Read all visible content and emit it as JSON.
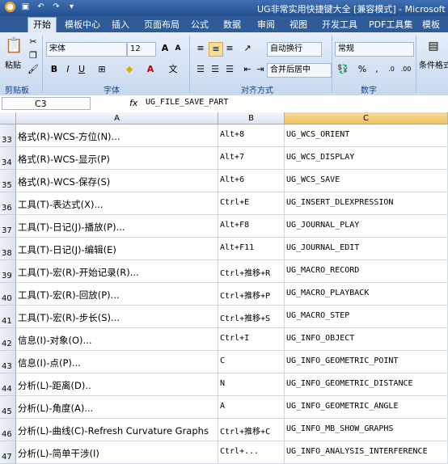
{
  "window": {
    "title": "UG非常实用快捷键大全 [兼容模式] - Microsoft"
  },
  "tabs": [
    "开始",
    "模板中心",
    "插入",
    "页面布局",
    "公式",
    "数据",
    "审阅",
    "视图",
    "开发工具",
    "PDF工具集",
    "模板"
  ],
  "ribbon": {
    "paste_label": "粘贴",
    "clipboard_label": "剪贴板",
    "font_name": "宋体",
    "font_size": "12",
    "font_group_label": "字体",
    "wrap_text_label": "自动换行",
    "merge_center_label": "合并后居中",
    "align_group_label": "对齐方式",
    "number_format": "常规",
    "number_group_label": "数字",
    "conditional_format_label": "条件格式"
  },
  "formula_bar": {
    "cell_ref": "C3",
    "fx": "fx",
    "content": "UG_FILE_SAVE_PART"
  },
  "columns": [
    "A",
    "B",
    "C"
  ],
  "rows": [
    {
      "num": "33",
      "a": "格式(R)-WCS-方位(N)...",
      "b": "Alt+8",
      "c": "UG_WCS_ORIENT"
    },
    {
      "num": "34",
      "a": "格式(R)-WCS-显示(P)",
      "b": "Alt+7",
      "c": "UG_WCS_DISPLAY"
    },
    {
      "num": "35",
      "a": "格式(R)-WCS-保存(S)",
      "b": "Alt+6",
      "c": "UG_WCS_SAVE"
    },
    {
      "num": "36",
      "a": "工具(T)-表达式(X)...",
      "b": "Ctrl+E",
      "c": "UG_INSERT_DLEXPRESSION"
    },
    {
      "num": "37",
      "a": "工具(T)-日记(J)-播放(P)...",
      "b": "Alt+F8",
      "c": "UG_JOURNAL_PLAY"
    },
    {
      "num": "38",
      "a": "工具(T)-日记(J)-编辑(E)",
      "b": "Alt+F11",
      "c": "UG_JOURNAL_EDIT"
    },
    {
      "num": "39",
      "a": "工具(T)-宏(R)-开始记录(R)...",
      "b": "Ctrl+推移+R",
      "c": "UG_MACRO_RECORD"
    },
    {
      "num": "40",
      "a": "工具(T)-宏(R)-回放(P)...",
      "b": "Ctrl+推移+P",
      "c": "UG_MACRO_PLAYBACK"
    },
    {
      "num": "41",
      "a": "工具(T)-宏(R)-步长(S)...",
      "b": "Ctrl+推移+S",
      "c": "UG_MACRO_STEP"
    },
    {
      "num": "42",
      "a": "信息(I)-对象(O)...",
      "b": "Ctrl+I",
      "c": "UG_INFO_OBJECT"
    },
    {
      "num": "43",
      "a": "信息(I)-点(P)...",
      "b": "C",
      "c": "UG_INFO_GEOMETRIC_POINT"
    },
    {
      "num": "44",
      "a": "分析(L)-距离(D)..",
      "b": "N",
      "c": "UG_INFO_GEOMETRIC_DISTANCE"
    },
    {
      "num": "45",
      "a": "分析(L)-角度(A)...",
      "b": "A",
      "c": "UG_INFO_GEOMETRIC_ANGLE"
    },
    {
      "num": "46",
      "a": "分析(L)-曲线(C)-Refresh Curvature Graphs",
      "b": "Ctrl+推移+C",
      "c": "UG_INFO_MB_SHOW_GRAPHS"
    },
    {
      "num": "47",
      "a": "分析(L)-简单干涉(I)",
      "b": "Ctrl+...",
      "c": "UG_INFO_ANALYSIS_INTERFERENCE"
    }
  ]
}
